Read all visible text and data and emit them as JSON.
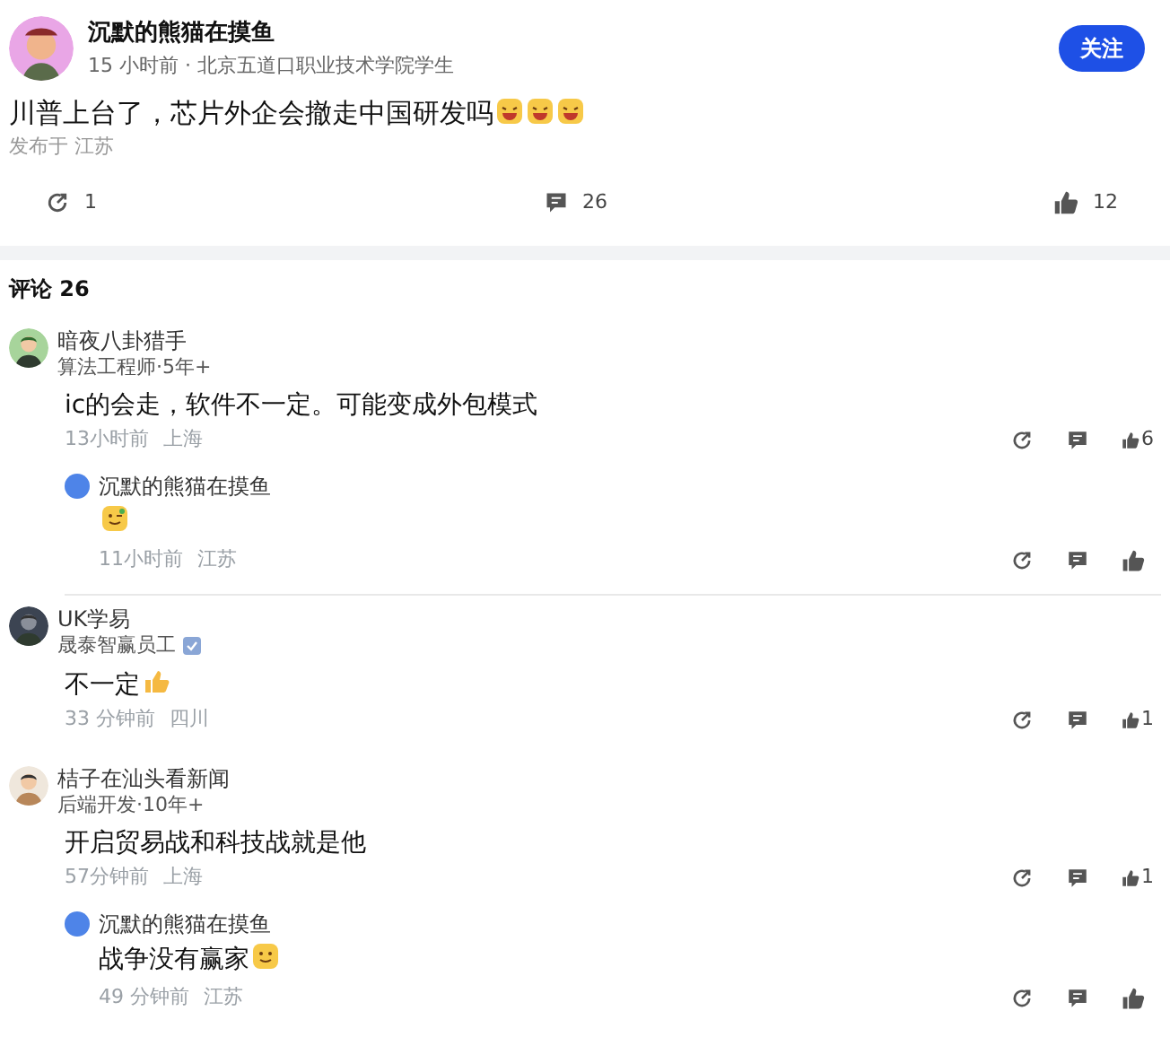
{
  "post": {
    "author": "沉默的熊猫在摸鱼",
    "meta": "15 小时前 · 北京五道口职业技术学院学生",
    "follow": "关注",
    "text": "川普上台了，芯片外企会撤走中国研发吗",
    "emojis": [
      {
        "kind": "laugh"
      },
      {
        "kind": "laugh"
      },
      {
        "kind": "laugh"
      }
    ],
    "location": "发布于 江苏",
    "reposts": "1",
    "comments": "26",
    "likes": "12"
  },
  "comments_title": "评论 26",
  "comments": [
    {
      "author": "暗夜八卦猎手",
      "role": "算法工程师·5年+",
      "verified": false,
      "text": "ic的会走，软件不一定。可能变成外包模式",
      "time": "13小时前",
      "location": "上海",
      "likes": "6",
      "children": [
        {
          "author": "沉默的熊猫在摸鱼",
          "emojis": [
            {
              "kind": "wink"
            }
          ],
          "time": "11小时前",
          "location": "江苏"
        }
      ]
    },
    {
      "author": "UK学易",
      "role": "晟泰智赢员工",
      "verified": true,
      "text": "不一定",
      "emojis": [
        {
          "kind": "thumb"
        }
      ],
      "time": "33 分钟前",
      "location": "四川",
      "likes": "1"
    },
    {
      "author": "桔子在汕头看新闻",
      "role": "后端开发·10年+",
      "verified": false,
      "text": "开启贸易战和科技战就是他",
      "time": "57分钟前",
      "location": "上海",
      "likes": "1",
      "children": [
        {
          "author": "沉默的熊猫在摸鱼",
          "text": "战争没有赢家",
          "emojis": [
            {
              "kind": "smile"
            }
          ],
          "time": "49 分钟前",
          "location": "江苏"
        }
      ]
    }
  ]
}
